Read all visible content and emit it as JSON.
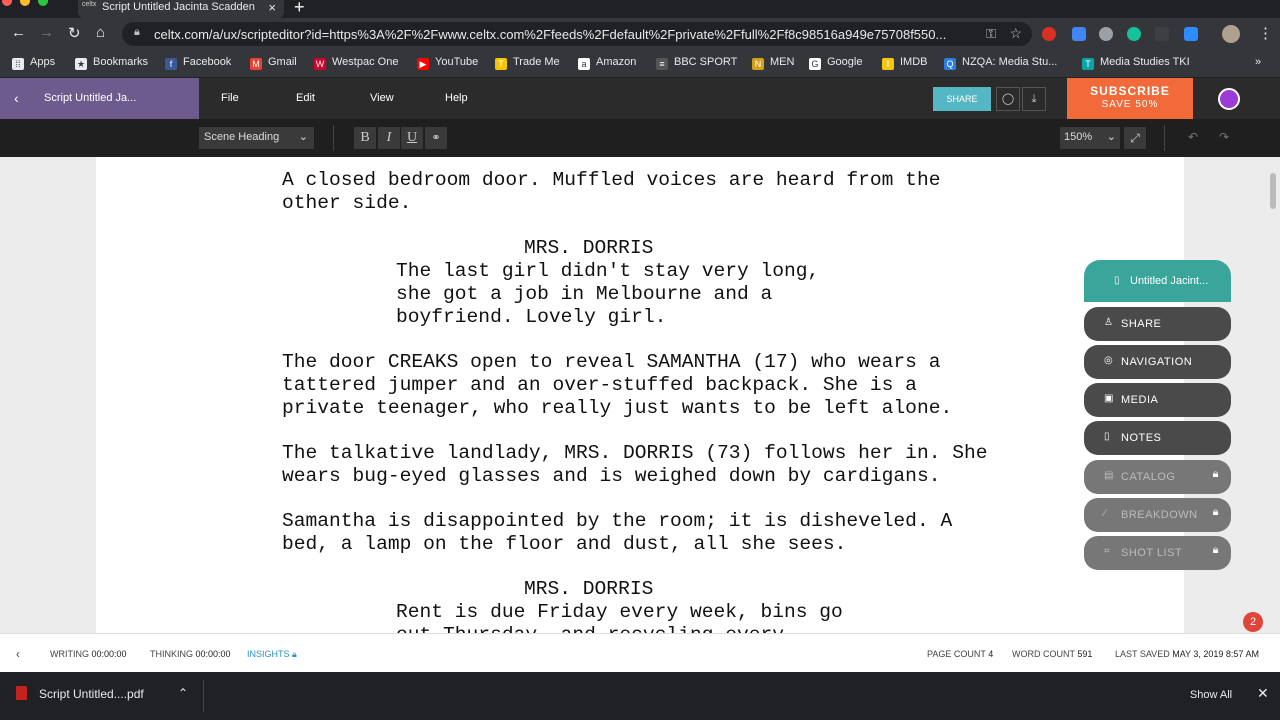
{
  "browser": {
    "tab_title": "Script Untitled Jacinta Scadden",
    "tab_favicon": "celtx",
    "url": "celtx.com/a/ux/scripteditor?id=https%3A%2F%2Fwww.celtx.com%2Ffeeds%2Fdefault%2Fprivate%2Ffull%2Ff8c98516a949e75708f550..."
  },
  "bookmarks": [
    {
      "label": "Apps",
      "icon": "apps-grid-icon",
      "color": "#e8eaed"
    },
    {
      "label": "Bookmarks",
      "icon": "star-icon",
      "color": "#e8eaed"
    },
    {
      "label": "Facebook",
      "icon": "facebook-icon",
      "color": "#3b5998"
    },
    {
      "label": "Gmail",
      "icon": "gmail-icon",
      "color": "#ea4335"
    },
    {
      "label": "Westpac One",
      "icon": "westpac-icon",
      "color": "#d5002b"
    },
    {
      "label": "YouTube",
      "icon": "youtube-icon",
      "color": "#ff0000"
    },
    {
      "label": "Trade Me",
      "icon": "trademe-icon",
      "color": "#f6c400"
    },
    {
      "label": "Amazon",
      "icon": "amazon-icon",
      "color": "#ffffff"
    },
    {
      "label": "BBC SPORT",
      "icon": "bbc-icon",
      "color": "#555555"
    },
    {
      "label": "MEN",
      "icon": "men-icon",
      "color": "#d4a017"
    },
    {
      "label": "Google",
      "icon": "google-icon",
      "color": "#ffffff"
    },
    {
      "label": "IMDB",
      "icon": "imdb-icon",
      "color": "#f5c518"
    },
    {
      "label": "NZQA: Media Stu...",
      "icon": "nzqa-icon",
      "color": "#2a7de1"
    },
    {
      "label": "Media Studies TKI",
      "icon": "tki-icon",
      "color": "#0aa3a8"
    }
  ],
  "app": {
    "doc_tab": "Script Untitled Ja...",
    "menus": [
      "File",
      "Edit",
      "View",
      "Help"
    ],
    "share_label": "SHARE",
    "subscribe_line1": "SUBSCRIBE",
    "subscribe_line2": "SAVE 50%",
    "accent_color": "#6e5b8e"
  },
  "toolbar": {
    "element_type": "Scene Heading",
    "bold": "B",
    "italic": "I",
    "underline": "U",
    "zoom": "150%"
  },
  "script": {
    "lines": [
      "A closed bedroom door. Muffled voices are heard from the",
      "other side.",
      "MRS. DORRIS",
      "The last girl didn't stay very long,",
      "she got a job in Melbourne and a",
      "boyfriend. Lovely girl.",
      "The door CREAKS open to reveal SAMANTHA (17) who wears a",
      "tattered jumper and an over-stuffed backpack. She is a",
      "private teenager, who really just wants to be left alone.",
      "The talkative landlady, MRS. DORRIS (73) follows her in. She",
      "wears bug-eyed glasses and is weighed down by cardigans.",
      "Samantha is disappointed by the room; it is disheveled. A",
      "bed, a lamp on the floor and dust, all she sees.",
      "MRS. DORRIS",
      "Rent is due Friday every week, bins go",
      "out Thursday, and recycling every"
    ]
  },
  "panel": {
    "doc": "Untitled Jacint...",
    "items": [
      {
        "label": "SHARE",
        "icon": "share-icon",
        "locked": false
      },
      {
        "label": "NAVIGATION",
        "icon": "compass-icon",
        "locked": false
      },
      {
        "label": "MEDIA",
        "icon": "image-icon",
        "locked": false
      },
      {
        "label": "NOTES",
        "icon": "note-icon",
        "locked": false
      },
      {
        "label": "CATALOG",
        "icon": "catalog-icon",
        "locked": true
      },
      {
        "label": "BREAKDOWN",
        "icon": "breakdown-icon",
        "locked": true
      },
      {
        "label": "SHOT LIST",
        "icon": "shotlist-icon",
        "locked": true
      }
    ],
    "notification_count": "2"
  },
  "status": {
    "writing_label": "WRITING",
    "writing_time": "00:00:00",
    "thinking_label": "THINKING",
    "thinking_time": "00:00:00",
    "insights": "INSIGHTS",
    "page_count_label": "PAGE COUNT",
    "page_count": "4",
    "word_count_label": "WORD COUNT",
    "word_count": "591",
    "last_saved_label": "LAST SAVED",
    "last_saved": "MAY 3, 2019 8:57 AM"
  },
  "downloads": {
    "file": "Script Untitled....pdf",
    "show_all": "Show All"
  }
}
